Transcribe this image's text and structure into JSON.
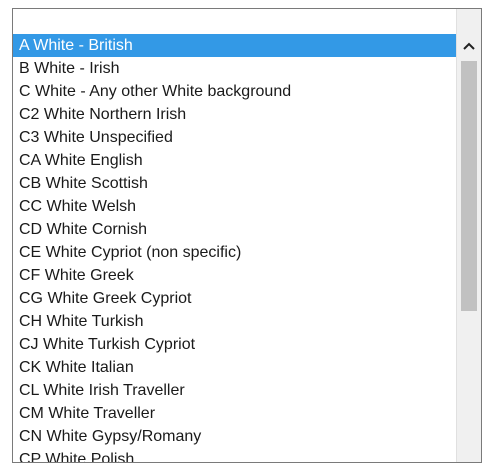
{
  "listbox": {
    "selected_index": 0,
    "options": [
      "A White - British",
      "B White - Irish",
      "C White - Any other White background",
      "C2 White Northern Irish",
      "C3 White Unspecified",
      "CA White English",
      "CB White Scottish",
      "CC White Welsh",
      "CD White Cornish",
      "CE White Cypriot (non specific)",
      "CF White Greek",
      "CG White Greek Cypriot",
      "CH White Turkish",
      "CJ White Turkish Cypriot",
      "CK White Italian",
      "CL White Irish Traveller",
      "CM White Traveller",
      "CN White Gypsy/Romany",
      "CP White Polish"
    ]
  },
  "colors": {
    "selection": "#3399e6",
    "scrollbar_track": "#f0f0f0",
    "scrollbar_thumb": "#c1c1c1"
  },
  "icons": {
    "scroll_up": "chevron-up-icon"
  }
}
